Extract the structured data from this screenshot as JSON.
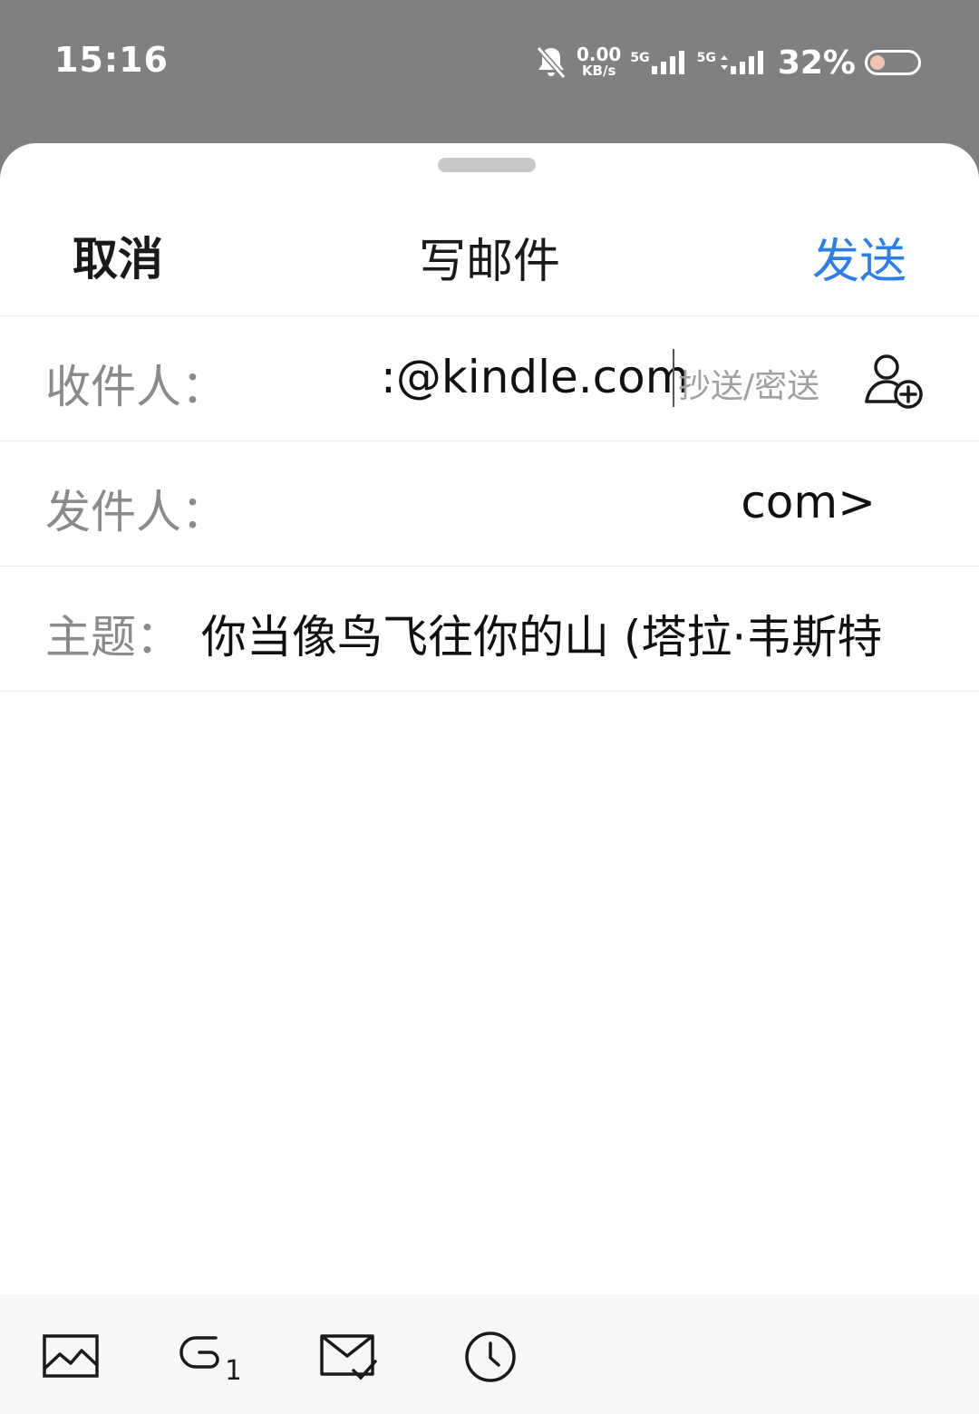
{
  "status": {
    "time": "15:16",
    "net_speed_value": "0.00",
    "net_speed_unit": "KB/s",
    "sim1_tag": "5G",
    "sim2_tag": "5G",
    "battery_percent": "32%",
    "battery_level": 0.32,
    "icons": [
      "bell-muted-icon",
      "signal-icon",
      "signal-icon",
      "battery-icon"
    ]
  },
  "nav": {
    "cancel_label": "取消",
    "title": "写邮件",
    "send_label": "发送",
    "accent_color": "#2f7fe0"
  },
  "fields": {
    "to_label": "收件人：",
    "to_value": ":@kindle.com",
    "cc_bcc_label": "抄送/密送",
    "from_label": "发件人：",
    "from_value": "com>",
    "subject_label": "主题：",
    "subject_value": "你当像鸟飞往你的山 (塔拉·韦斯特"
  },
  "toolbar": {
    "icons": [
      "image-icon",
      "attachment-icon",
      "receipt-icon",
      "schedule-icon"
    ],
    "attachment_count": "1"
  }
}
